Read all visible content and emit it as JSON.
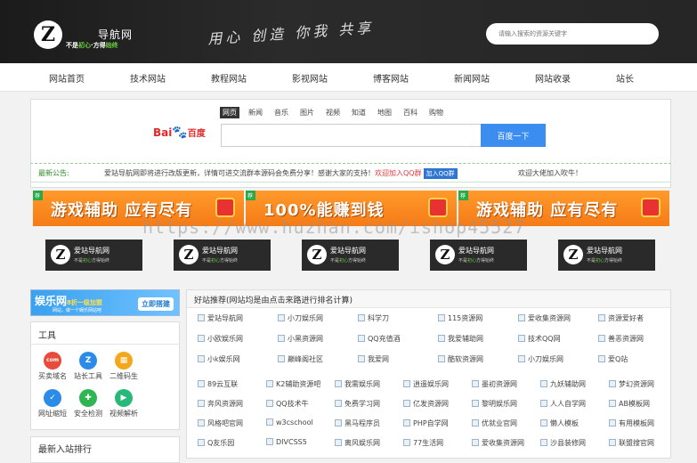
{
  "header": {
    "logo_letter": "Z",
    "logo_title": "导航网",
    "logo_sub_prefix": "不是",
    "logo_sub_green1": "初心",
    "logo_sub_mid": "方得",
    "logo_sub_green2": "始终",
    "slogan": "用心 创造 你我 共享",
    "search_placeholder": "请输入搜索的资源关键字"
  },
  "nav": {
    "items": [
      "网站首页",
      "技术网站",
      "教程网站",
      "影视网站",
      "博客网站",
      "新闻网站",
      "网站收录",
      "站长"
    ]
  },
  "search": {
    "tabs": [
      "网页",
      "新闻",
      "音乐",
      "图片",
      "视频",
      "知道",
      "地图",
      "百科",
      "购物"
    ],
    "active_tab": "网页",
    "logo_left": "Bai",
    "logo_paw": "🐾",
    "logo_right": "百度",
    "button_label": "百度一下"
  },
  "notice": {
    "label": "最新公告:",
    "text": "爱站导航网即将进行改版更新，详情可进交流群本源码会免费分享！感谢大家的支持！",
    "red_text": "欢迎加入QQ群",
    "qq_button": "加入QQ群",
    "text2": "欢迎大佬加入吹牛！"
  },
  "banners": [
    {
      "tag": "荐",
      "text": "游戏辅助 应有尽有"
    },
    {
      "tag": "荐",
      "text": "100%能赚到钱"
    },
    {
      "tag": "荐",
      "text": "游戏辅助 应有尽有"
    }
  ],
  "watermark": "https://www.huzhan.com/ishop45527",
  "logo_cards": {
    "title": "爱站导航网",
    "sub_prefix": "不是",
    "sub_green": "初心",
    "sub_suffix": "方得始终"
  },
  "left_ad": {
    "title": "娱乐网",
    "highlight": "8折一级加盟",
    "sub": "网站，做一个娱乐网站吧",
    "button": "立即搭建"
  },
  "tools": {
    "title": "工具",
    "items": [
      {
        "label": "买卖域名",
        "icon": "domain-icon",
        "color": "#e84b3c",
        "glyph": "com"
      },
      {
        "label": "站长工具",
        "icon": "z-tool-icon",
        "color": "#2d8be8",
        "glyph": "Z"
      },
      {
        "label": "二维码生",
        "icon": "qrcode-icon",
        "color": "#f2a81a",
        "glyph": "▦"
      },
      {
        "label": "网址缩短",
        "icon": "shield-icon",
        "color": "#2d8be8",
        "glyph": "✓"
      },
      {
        "label": "安全检测",
        "icon": "safety-icon",
        "color": "#2fb552",
        "glyph": "✚"
      },
      {
        "label": "视频解析",
        "icon": "video-icon",
        "color": "#27b87a",
        "glyph": "▶"
      }
    ]
  },
  "rank": {
    "title": "最新入站排行"
  },
  "links": {
    "title": "好站推荐(网站均是由点击来路进行排名计算)",
    "rows": [
      [
        "爱站导航网",
        "小刀娱乐网",
        "科学刀",
        "115资源网",
        "爱收集资源网",
        "资源爱好者"
      ],
      [
        "小欧娱乐网",
        "小黑资源网",
        "QQ充值酒",
        "我爱辅助网",
        "技术QQ网",
        "善恶资源网"
      ],
      [
        "小k娱乐网",
        "巅峰阁社区",
        "我爱网",
        "酷软资源网",
        "小刀娱乐网",
        "爱Q站"
      ],
      [
        "89云互联",
        "K2辅助资源吧",
        "我需娱乐网",
        "逍遥娱乐网",
        "墨初资源网",
        "九妖辅助网",
        "梦幻资源网"
      ],
      [
        "奔风资源网",
        "QQ技术牛",
        "免费学习网",
        "亿发资源网",
        "黎明娱乐网",
        "人人自学网",
        "AB模板网"
      ],
      [
        "风格吧官网",
        "w3cschool",
        "黑马程序员",
        "PHP自学网",
        "优就业官网",
        "懒人模板",
        "有用模板网"
      ],
      [
        "Q友乐园",
        "DIVCSS5",
        "离风娱乐网",
        "77生活网",
        "爱收集资源网",
        "沙县装修网",
        "联盟搜官网"
      ]
    ]
  }
}
